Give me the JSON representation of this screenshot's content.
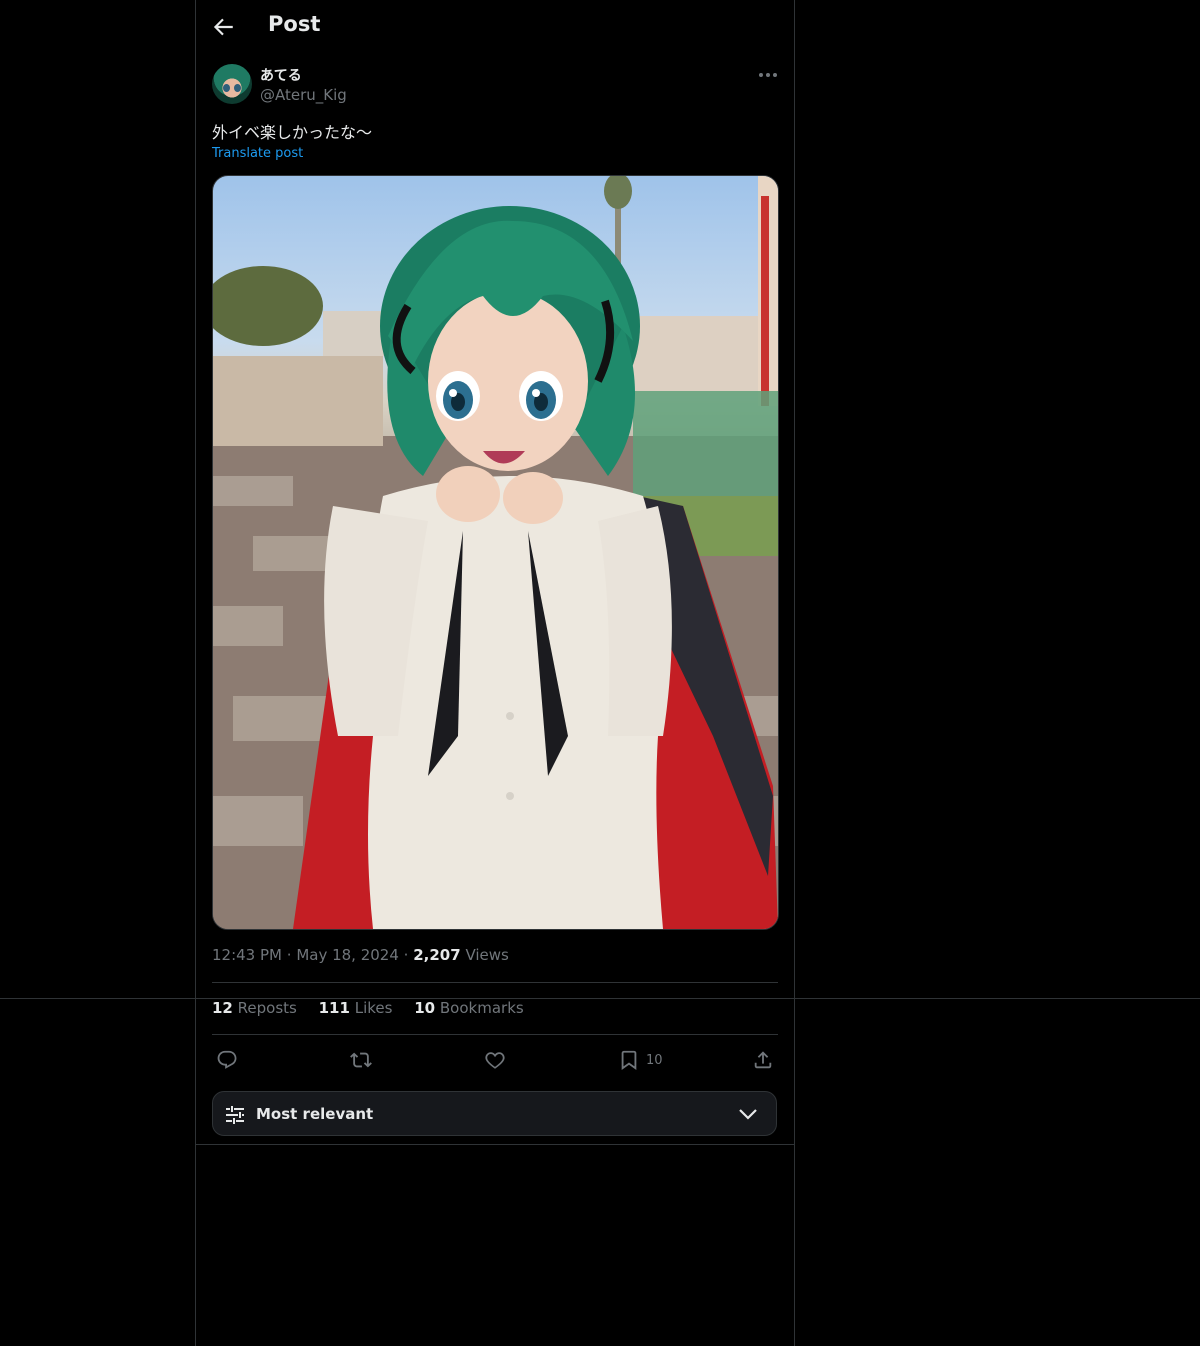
{
  "header": {
    "title": "Post",
    "back_icon": "arrow-left-icon"
  },
  "author": {
    "display_name": "あてる",
    "handle": "@Ateru_Kig"
  },
  "post": {
    "text": "外イベ楽しかったな〜",
    "translate_label": "Translate post",
    "time": "12:43 PM",
    "date": "May 18, 2024",
    "views_count": "2,207",
    "views_label": "Views"
  },
  "stats": {
    "reposts_count": "12",
    "reposts_label": "Reposts",
    "likes_count": "111",
    "likes_label": "Likes",
    "bookmarks_count": "10",
    "bookmarks_label": "Bookmarks"
  },
  "actions": {
    "reply_icon": "reply-icon",
    "repost_icon": "repost-icon",
    "like_icon": "heart-icon",
    "bookmark_icon": "bookmark-icon",
    "bookmark_count": "10",
    "share_icon": "share-icon"
  },
  "sort": {
    "label": "Most relevant",
    "icon": "filter-icon",
    "chevron": "chevron-down-icon"
  },
  "colors": {
    "background": "#000000",
    "text": "#e7e9ea",
    "secondary": "#71767b",
    "link": "#1d9bf0",
    "border": "#2f3336"
  }
}
